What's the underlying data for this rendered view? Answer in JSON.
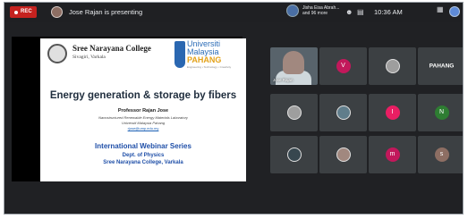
{
  "topbar": {
    "rec_label": "REC",
    "presenting_text": "Jose Rajan is presenting",
    "participants_line1": "Jisha Eisa Abrah...",
    "participants_line2": "and 96 more",
    "time": "10:36 AM"
  },
  "slide": {
    "college_name": "Sree Narayana College",
    "college_place": "Sivagiri, Varkala",
    "um_line1": "Universiti",
    "um_line2": "Malaysia",
    "um_line3": "PAHANG",
    "um_tagline": "Engineering • Technology • Creativity",
    "title": "Energy generation & storage by fibers",
    "professor": "Professor Rajan Jose",
    "lab": "Nanostructured Renewable Energy Materials Laboratory",
    "university": "Universiti Malaysia Pahang",
    "email": "rjose@ump.edu.my",
    "webinar": "International Webinar Series",
    "dept": "Dept. of Physics",
    "college_footer": "Sree Narayana College, Varkala"
  },
  "tiles": {
    "video_name": "Jose Rajan",
    "v_initial": "V",
    "logo_text": "PAHANG",
    "i_initial": "I",
    "n_initial": "N",
    "m_initial": "m",
    "s_initial": "s"
  },
  "colors": {
    "tile_v": "#c2185b",
    "tile_i": "#e91e63",
    "tile_n": "#2e7d32",
    "tile_m": "#c2185b",
    "tile_s": "#8d6e63"
  }
}
